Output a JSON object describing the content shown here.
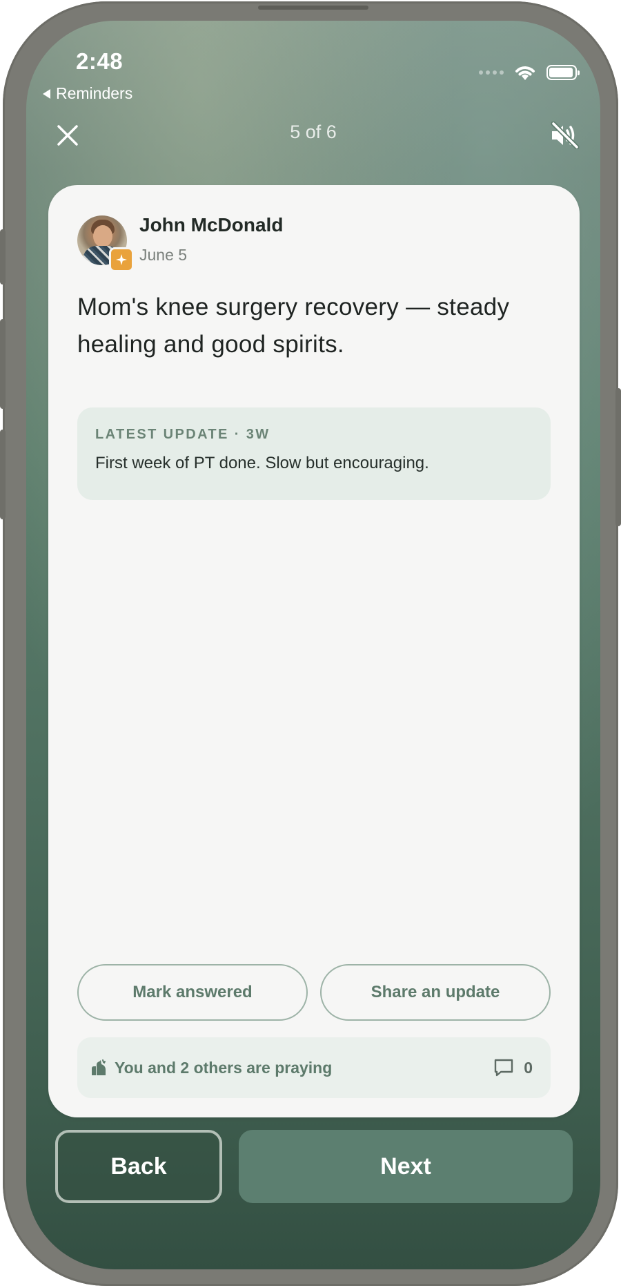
{
  "status_bar": {
    "time": "2:48",
    "back_app": "Reminders"
  },
  "nav": {
    "counter": "5 of 6",
    "close_icon": "close-icon",
    "mute_icon": "speaker-muted-icon"
  },
  "request": {
    "author": "John McDonald",
    "date": "June 5",
    "title": "Mom's knee surgery recovery — steady healing and good spirits.",
    "latest_update": {
      "label": "LATEST UPDATE · 3W",
      "text": "First week of PT done. Slow but encouraging."
    },
    "actions": {
      "mark_answered": "Mark answered",
      "share_update": "Share an update"
    },
    "prayer": {
      "text": "You and 2 others are praying",
      "comment_count": "0"
    }
  },
  "footer": {
    "back": "Back",
    "next": "Next"
  },
  "colors": {
    "accent": "#5c7f70",
    "badge": "#e9a23c",
    "card": "#f6f6f5"
  }
}
